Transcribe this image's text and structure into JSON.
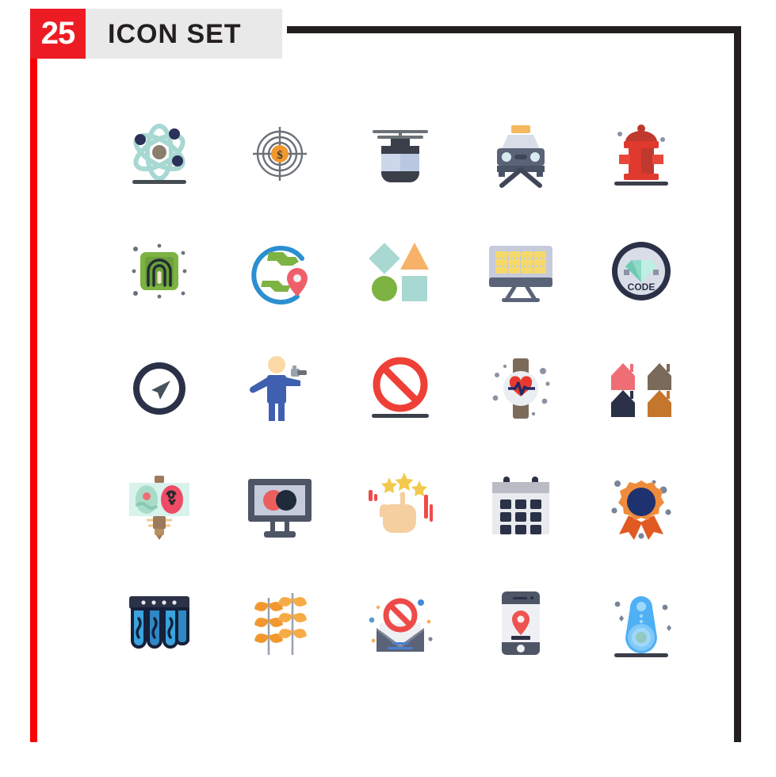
{
  "header": {
    "count": "25",
    "title": "ICON SET"
  },
  "colors": {
    "badge_red": "#ed1c24",
    "frame_black": "#231f20",
    "frame_red": "#fb0000",
    "title_plate": "#e9e9e9",
    "background": "#ffffff"
  },
  "grid": {
    "columns": 5,
    "rows": 5,
    "total": 25
  },
  "icons": [
    {
      "name": "atom-icon",
      "label": "Atom",
      "row": 1,
      "col": 1
    },
    {
      "name": "target-dollar-icon",
      "label": "Target Dollar",
      "row": 1,
      "col": 2
    },
    {
      "name": "cable-car-icon",
      "label": "Cable Car",
      "row": 1,
      "col": 3
    },
    {
      "name": "car-front-icon",
      "label": "Car Front",
      "row": 1,
      "col": 4
    },
    {
      "name": "fire-hydrant-icon",
      "label": "Fire Hydrant",
      "row": 1,
      "col": 5
    },
    {
      "name": "fingerprint-chip-icon",
      "label": "Fingerprint Chip",
      "row": 2,
      "col": 1
    },
    {
      "name": "globe-location-icon",
      "label": "Globe Location",
      "row": 2,
      "col": 2
    },
    {
      "name": "shapes-icon",
      "label": "Shapes",
      "row": 2,
      "col": 3
    },
    {
      "name": "monitor-grid-icon",
      "label": "Monitor Grid",
      "row": 2,
      "col": 4
    },
    {
      "name": "code-badge-icon",
      "label": "Code Badge",
      "row": 2,
      "col": 5,
      "text": "CODE"
    },
    {
      "name": "navigation-icon",
      "label": "Navigation",
      "row": 3,
      "col": 1
    },
    {
      "name": "person-camera-icon",
      "label": "Person Camera",
      "row": 3,
      "col": 2
    },
    {
      "name": "forbidden-icon",
      "label": "Forbidden",
      "row": 3,
      "col": 3
    },
    {
      "name": "smartwatch-heart-icon",
      "label": "Smartwatch Heart",
      "row": 3,
      "col": 4
    },
    {
      "name": "houses-icon",
      "label": "Houses",
      "row": 3,
      "col": 5
    },
    {
      "name": "easter-eggs-sign-icon",
      "label": "Easter Eggs Sign",
      "row": 4,
      "col": 1
    },
    {
      "name": "monitor-circles-icon",
      "label": "Monitor Circles",
      "row": 4,
      "col": 2
    },
    {
      "name": "hand-stars-icon",
      "label": "Hand Stars",
      "row": 4,
      "col": 3
    },
    {
      "name": "calendar-icon",
      "label": "Calendar",
      "row": 4,
      "col": 4
    },
    {
      "name": "award-rosette-icon",
      "label": "Award Rosette",
      "row": 4,
      "col": 5
    },
    {
      "name": "water-filter-icon",
      "label": "Water Filter",
      "row": 5,
      "col": 1
    },
    {
      "name": "wheat-icon",
      "label": "Wheat",
      "row": 5,
      "col": 2
    },
    {
      "name": "blocked-mail-icon",
      "label": "Blocked Mail",
      "row": 5,
      "col": 3
    },
    {
      "name": "phone-location-icon",
      "label": "Phone Location",
      "row": 5,
      "col": 4
    },
    {
      "name": "speaker-icon",
      "label": "Speaker",
      "row": 5,
      "col": 5
    }
  ]
}
